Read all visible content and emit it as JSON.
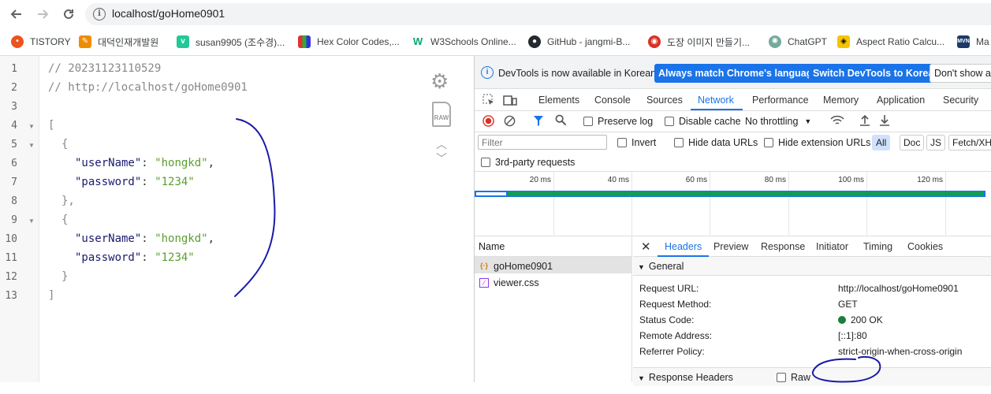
{
  "browser": {
    "url": "localhost/goHome0901",
    "bookmarks": [
      {
        "label": "TISTORY",
        "icon": "tistory-icon",
        "color": "#eb531f"
      },
      {
        "label": "대덕인재개발원",
        "icon": "ddit-icon",
        "color": "#f08c00"
      },
      {
        "label": "susan9905 (조수경)...",
        "icon": "velog-icon",
        "color": "#20c997"
      },
      {
        "label": "Hex Color Codes,...",
        "icon": "hex-color-icon",
        "color": "#4a6cf7"
      },
      {
        "label": "W3Schools Online...",
        "icon": "w3schools-icon",
        "color": "#04aa6d"
      },
      {
        "label": "GitHub - jangmi-B...",
        "icon": "github-icon",
        "color": "#24292f"
      },
      {
        "label": "도장 이미지 만들기...",
        "icon": "stamp-icon",
        "color": "#d93025"
      },
      {
        "label": "ChatGPT",
        "icon": "chatgpt-icon",
        "color": "#74aa9c"
      },
      {
        "label": "Aspect Ratio Calcu...",
        "icon": "aspect-ratio-icon",
        "color": "#f5c400"
      },
      {
        "label": "Ma",
        "icon": "mvn-icon",
        "color": "#1b3a6b"
      }
    ]
  },
  "viewer": {
    "lines": [
      {
        "n": "1",
        "fold": ""
      },
      {
        "n": "2",
        "fold": ""
      },
      {
        "n": "3",
        "fold": ""
      },
      {
        "n": "4",
        "fold": "▼"
      },
      {
        "n": "5",
        "fold": "▼"
      },
      {
        "n": "6",
        "fold": ""
      },
      {
        "n": "7",
        "fold": ""
      },
      {
        "n": "8",
        "fold": ""
      },
      {
        "n": "9",
        "fold": "▼"
      },
      {
        "n": "10",
        "fold": ""
      },
      {
        "n": "11",
        "fold": ""
      },
      {
        "n": "12",
        "fold": ""
      },
      {
        "n": "13",
        "fold": ""
      }
    ],
    "comment1": "// 20231123110529",
    "comment2": "// http://localhost/goHome0901",
    "open_bracket": "[",
    "close_bracket": "]",
    "open_brace": "{",
    "close_brace1": "},",
    "close_brace2": "}",
    "key_user": "\"userName\"",
    "key_pass": "\"password\"",
    "colon": ": ",
    "comma": ",",
    "val_user": "\"hongkd\"",
    "val_pass": "\"1234\"",
    "raw_label": "RAW"
  },
  "devtools": {
    "info_message": "DevTools is now available in Korean!",
    "btn_match": "Always match Chrome's language",
    "btn_switch": "Switch DevTools to Korean",
    "btn_dont": "Don't show ag",
    "tabs": [
      "Elements",
      "Console",
      "Sources",
      "Network",
      "Performance",
      "Memory",
      "Application",
      "Security"
    ],
    "active_tab": "Network",
    "preserve_log": "Preserve log",
    "disable_cache": "Disable cache",
    "throttling": "No throttling",
    "filter_placeholder": "Filter",
    "invert": "Invert",
    "hide_data_urls": "Hide data URLs",
    "hide_ext_urls": "Hide extension URLs",
    "type_chips": [
      "All",
      "Doc",
      "JS",
      "Fetch/XHR"
    ],
    "third_party": "3rd-party requests",
    "timeline_ticks": [
      "20 ms",
      "40 ms",
      "60 ms",
      "80 ms",
      "100 ms",
      "120 ms"
    ],
    "name_header": "Name",
    "requests": [
      {
        "name": "goHome0901",
        "icon": "json-file-icon",
        "selected": true
      },
      {
        "name": "viewer.css",
        "icon": "css-file-icon",
        "selected": false
      }
    ],
    "detail_tabs": [
      "Headers",
      "Preview",
      "Response",
      "Initiator",
      "Timing",
      "Cookies"
    ],
    "active_detail_tab": "Headers",
    "general_label": "General",
    "general": [
      {
        "k": "Request URL:",
        "v": "http://localhost/goHome0901"
      },
      {
        "k": "Request Method:",
        "v": "GET"
      },
      {
        "k": "Status Code:",
        "v": "200 OK"
      },
      {
        "k": "Remote Address:",
        "v": "[::1]:80"
      },
      {
        "k": "Referrer Policy:",
        "v": "strict-origin-when-cross-origin"
      }
    ],
    "response_headers_label": "Response Headers",
    "raw_checkbox": "Raw",
    "status_color": "#188038"
  }
}
